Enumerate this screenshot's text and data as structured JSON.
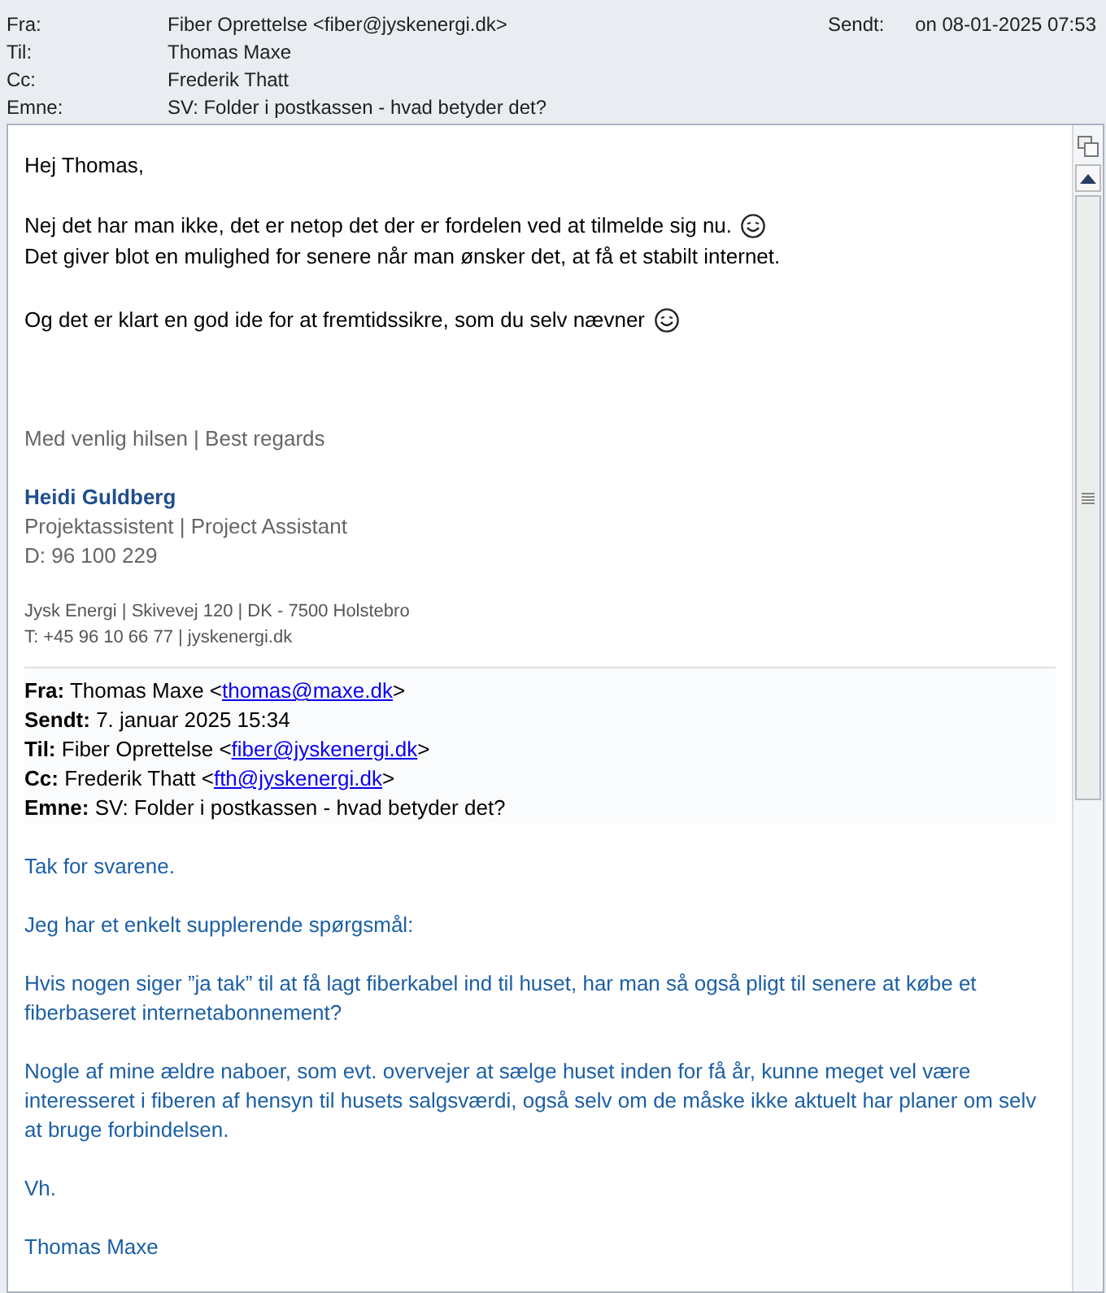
{
  "header": [
    {
      "label": "Fra:",
      "value": "Fiber Oprettelse <fiber@jyskenergi.dk>"
    },
    {
      "label": "Til:",
      "value": "Thomas Maxe"
    },
    {
      "label": "Cc:",
      "value": "Frederik Thatt"
    },
    {
      "label": "Emne:",
      "value": "SV: Folder i postkassen - hvad betyder det?"
    }
  ],
  "sent": {
    "label": "Sendt:",
    "value": "on 08-01-2025 07:53"
  },
  "greeting": "Hej Thomas,",
  "paragraphs": [
    [
      {
        "text": "Nej det har man ikke, det er netop det der er fordelen ved at tilmelde sig nu.",
        "smiley": true
      },
      {
        "text": "Det giver blot en mulighed for senere når man ønsker det, at få et stabilt internet.",
        "smiley": false
      }
    ],
    [
      {
        "text": "Og det er klart en god ide for at fremtidssikre, som du selv nævner",
        "smiley": true
      }
    ]
  ],
  "signature": {
    "closing": "Med venlig hilsen | Best regards",
    "name": "Heidi Guldberg",
    "title": "Projektassistent | Project Assistant",
    "phone": "D: 96 100 229",
    "address": "Jysk Energi  | Skivevej 120 | DK - 7500 Holstebro",
    "contact": "T: +45 96 10 66 77 |  jyskenergi.dk"
  },
  "quoted_header": [
    {
      "label": "Fra:",
      "before": "Thomas Maxe <",
      "link": "thomas@maxe.dk",
      "after": ">"
    },
    {
      "label": "Sendt:",
      "before": "7. januar 2025 15:34"
    },
    {
      "label": "Til:",
      "before": "Fiber Oprettelse <",
      "link": "fiber@jyskenergi.dk",
      "after": ">"
    },
    {
      "label": "Cc:",
      "before": "Frederik Thatt <",
      "link": "fth@jyskenergi.dk",
      "after": ">"
    },
    {
      "label": "Emne:",
      "before": "SV: Folder i postkassen - hvad betyder det?"
    }
  ],
  "quoted_body": [
    "Tak for svarene.",
    "Jeg har et enkelt supplerende spørgsmål:",
    "Hvis nogen siger ”ja tak” til at få lagt fiberkabel ind til huset, har man så også pligt til senere at købe et fiberbaseret internetabonnement?",
    "Nogle af mine ældre naboer, som evt. overvejer at sælge huset inden for få år, kunne meget vel være interesseret i fiberen af hensyn til husets salgsværdi, også selv om de måske ikke aktuelt har planer om selv at bruge forbindelsen.",
    "Vh.",
    "Thomas Maxe"
  ]
}
